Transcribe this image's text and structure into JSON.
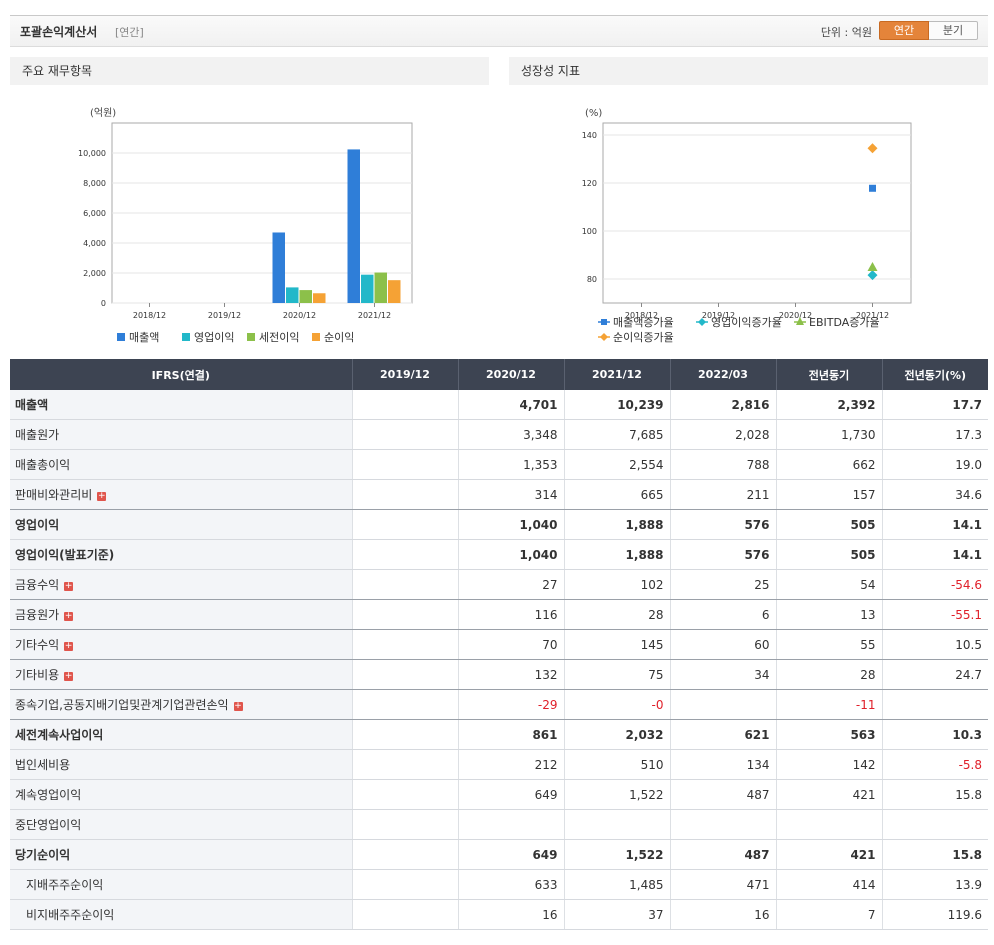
{
  "header": {
    "title": "포괄손익계산서",
    "subtitle": "[연간]",
    "unit": "단위 : 억원",
    "toggle_annual": "연간",
    "toggle_quarter": "분기"
  },
  "colors": {
    "accent": "#e4843a",
    "table_header": "#3d4452",
    "negative": "#e0202a"
  },
  "left_panel": {
    "title": "주요 재무항목"
  },
  "right_panel": {
    "title": "성장성 지표"
  },
  "chart_data": [
    {
      "type": "bar",
      "title": "",
      "ylabel": "(억원)",
      "categories": [
        "2018/12",
        "2019/12",
        "2020/12",
        "2021/12"
      ],
      "ylim": [
        0,
        12000
      ],
      "yticks": [
        0,
        2000,
        4000,
        6000,
        8000,
        10000
      ],
      "ytick_labels": [
        "0",
        "2,000",
        "4,000",
        "6,000",
        "8,000",
        "10,000"
      ],
      "grid": true,
      "legend": "bottom",
      "series": [
        {
          "name": "매출액",
          "color": "#2f7ed8",
          "values": [
            null,
            null,
            4701,
            10239
          ]
        },
        {
          "name": "영업이익",
          "color": "#22b8c9",
          "values": [
            null,
            null,
            1040,
            1888
          ]
        },
        {
          "name": "세전이익",
          "color": "#8cc04a",
          "values": [
            null,
            null,
            861,
            2032
          ]
        },
        {
          "name": "순이익",
          "color": "#f5a235",
          "values": [
            null,
            null,
            649,
            1522
          ]
        }
      ]
    },
    {
      "type": "scatter",
      "title": "",
      "ylabel": "(%)",
      "categories": [
        "2018/12",
        "2019/12",
        "2020/12",
        "2021/12"
      ],
      "ylim": [
        70,
        145
      ],
      "yticks": [
        80,
        100,
        120,
        140
      ],
      "ytick_labels": [
        "80",
        "100",
        "120",
        "140"
      ],
      "grid": true,
      "legend": "bottom",
      "series": [
        {
          "name": "매출액증가율",
          "color": "#2f7ed8",
          "marker": "square",
          "values": [
            null,
            null,
            null,
            117.8
          ]
        },
        {
          "name": "영업이익증가율",
          "color": "#22b8c9",
          "marker": "diamond",
          "values": [
            null,
            null,
            null,
            81.6
          ]
        },
        {
          "name": "EBITDA증가율",
          "color": "#8cc04a",
          "marker": "triangle",
          "values": [
            null,
            null,
            null,
            85
          ]
        },
        {
          "name": "순이익증가율",
          "color": "#f5a235",
          "marker": "diamond",
          "values": [
            null,
            null,
            null,
            134.5
          ]
        }
      ]
    }
  ],
  "table": {
    "columns": [
      "IFRS(연결)",
      "2019/12",
      "2020/12",
      "2021/12",
      "2022/03",
      "전년동기",
      "전년동기(%)"
    ],
    "rows": [
      {
        "label": "매출액",
        "values": [
          "",
          "4,701",
          "10,239",
          "2,816",
          "2,392",
          "17.7"
        ],
        "bold": true,
        "plus": false,
        "sep": false,
        "indent": false,
        "neg": []
      },
      {
        "label": "매출원가",
        "values": [
          "",
          "3,348",
          "7,685",
          "2,028",
          "1,730",
          "17.3"
        ],
        "bold": false,
        "plus": false,
        "sep": false,
        "indent": false,
        "neg": []
      },
      {
        "label": "매출총이익",
        "values": [
          "",
          "1,353",
          "2,554",
          "788",
          "662",
          "19.0"
        ],
        "bold": false,
        "plus": false,
        "sep": false,
        "indent": false,
        "neg": []
      },
      {
        "label": "판매비와관리비",
        "values": [
          "",
          "314",
          "665",
          "211",
          "157",
          "34.6"
        ],
        "bold": false,
        "plus": true,
        "sep": true,
        "indent": false,
        "neg": []
      },
      {
        "label": "영업이익",
        "values": [
          "",
          "1,040",
          "1,888",
          "576",
          "505",
          "14.1"
        ],
        "bold": true,
        "plus": false,
        "sep": false,
        "indent": false,
        "neg": []
      },
      {
        "label": "영업이익(발표기준)",
        "values": [
          "",
          "1,040",
          "1,888",
          "576",
          "505",
          "14.1"
        ],
        "bold": true,
        "plus": false,
        "sep": false,
        "indent": false,
        "neg": []
      },
      {
        "label": "금융수익",
        "values": [
          "",
          "27",
          "102",
          "25",
          "54",
          "-54.6"
        ],
        "bold": false,
        "plus": true,
        "sep": true,
        "indent": false,
        "neg": [
          5
        ]
      },
      {
        "label": "금융원가",
        "values": [
          "",
          "116",
          "28",
          "6",
          "13",
          "-55.1"
        ],
        "bold": false,
        "plus": true,
        "sep": true,
        "indent": false,
        "neg": [
          5
        ]
      },
      {
        "label": "기타수익",
        "values": [
          "",
          "70",
          "145",
          "60",
          "55",
          "10.5"
        ],
        "bold": false,
        "plus": true,
        "sep": true,
        "indent": false,
        "neg": []
      },
      {
        "label": "기타비용",
        "values": [
          "",
          "132",
          "75",
          "34",
          "28",
          "24.7"
        ],
        "bold": false,
        "plus": true,
        "sep": true,
        "indent": false,
        "neg": []
      },
      {
        "label": "종속기업,공동지배기업및관계기업관련손익",
        "values": [
          "",
          "-29",
          "-0",
          "",
          "-11",
          ""
        ],
        "bold": false,
        "plus": true,
        "sep": true,
        "indent": false,
        "neg": [
          1,
          2,
          4
        ]
      },
      {
        "label": "세전계속사업이익",
        "values": [
          "",
          "861",
          "2,032",
          "621",
          "563",
          "10.3"
        ],
        "bold": true,
        "plus": false,
        "sep": false,
        "indent": false,
        "neg": []
      },
      {
        "label": "법인세비용",
        "values": [
          "",
          "212",
          "510",
          "134",
          "142",
          "-5.8"
        ],
        "bold": false,
        "plus": false,
        "sep": false,
        "indent": false,
        "neg": [
          5
        ]
      },
      {
        "label": "계속영업이익",
        "values": [
          "",
          "649",
          "1,522",
          "487",
          "421",
          "15.8"
        ],
        "bold": false,
        "plus": false,
        "sep": false,
        "indent": false,
        "neg": []
      },
      {
        "label": "중단영업이익",
        "values": [
          "",
          "",
          "",
          "",
          "",
          ""
        ],
        "bold": false,
        "plus": false,
        "sep": false,
        "indent": false,
        "neg": []
      },
      {
        "label": "당기순이익",
        "values": [
          "",
          "649",
          "1,522",
          "487",
          "421",
          "15.8"
        ],
        "bold": true,
        "plus": false,
        "sep": false,
        "indent": false,
        "neg": []
      },
      {
        "label": "지배주주순이익",
        "values": [
          "",
          "633",
          "1,485",
          "471",
          "414",
          "13.9"
        ],
        "bold": false,
        "plus": false,
        "sep": false,
        "indent": true,
        "neg": []
      },
      {
        "label": "비지배주주순이익",
        "values": [
          "",
          "16",
          "37",
          "16",
          "7",
          "119.6"
        ],
        "bold": false,
        "plus": false,
        "sep": false,
        "indent": true,
        "neg": []
      }
    ]
  }
}
